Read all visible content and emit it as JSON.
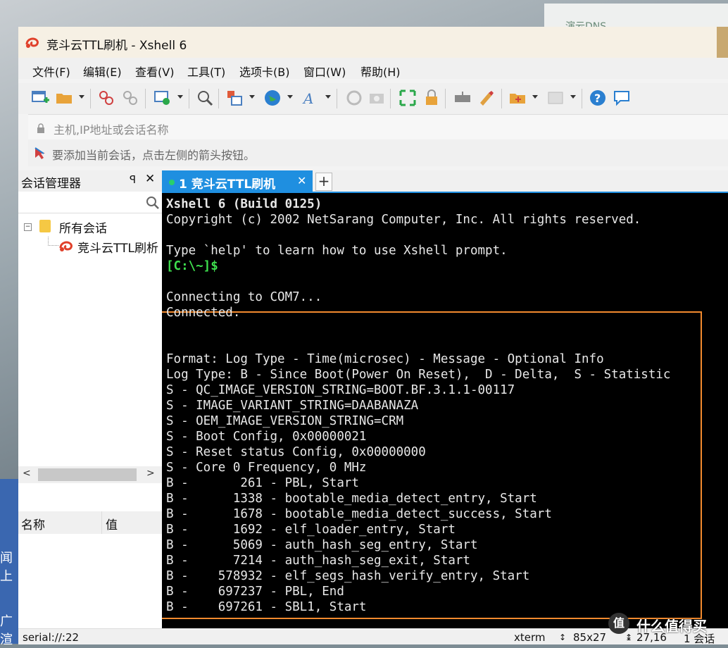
{
  "desktop": {
    "left_text_1": "闻上",
    "left_text_2": "广渲",
    "card_text": "演云DNS"
  },
  "window": {
    "title": "竞斗云TTL刷机 - Xshell 6"
  },
  "menu": [
    "文件(F)",
    "编辑(E)",
    "查看(V)",
    "工具(T)",
    "选项卡(B)",
    "窗口(W)",
    "帮助(H)"
  ],
  "address": {
    "placeholder": "主机,IP地址或会话名称"
  },
  "hint": {
    "text": "要添加当前会话，点击左侧的箭头按钮。"
  },
  "session_manager": {
    "title": "会话管理器",
    "pin": "ꟼ",
    "close": "✕",
    "tree": {
      "root": "所有会话",
      "child": "竞斗云TTL刷析"
    },
    "prop_cols": [
      "名称",
      "值"
    ]
  },
  "tabs": [
    {
      "label": "1 竞斗云TTL刷机",
      "close": "✕"
    }
  ],
  "tab_add": "+",
  "terminal": {
    "lines": [
      {
        "text": "Xshell 6 (Build 0125)",
        "style": "bold"
      },
      {
        "text": "Copyright (c) 2002 NetSarang Computer, Inc. All rights reserved.",
        "style": ""
      },
      {
        "text": "",
        "style": ""
      },
      {
        "text": "Type `help' to learn how to use Xshell prompt.",
        "style": ""
      },
      {
        "text": "[C:\\~]$",
        "style": "prompt"
      },
      {
        "text": "",
        "style": ""
      },
      {
        "text": "Connecting to COM7...",
        "style": ""
      },
      {
        "text": "Connected.",
        "style": ""
      },
      {
        "text": "",
        "style": ""
      },
      {
        "text": "",
        "style": ""
      },
      {
        "text": "Format: Log Type - Time(microsec) - Message - Optional Info",
        "style": ""
      },
      {
        "text": "Log Type: B - Since Boot(Power On Reset),  D - Delta,  S - Statistic",
        "style": ""
      },
      {
        "text": "S - QC_IMAGE_VERSION_STRING=BOOT.BF.3.1.1-00117",
        "style": ""
      },
      {
        "text": "S - IMAGE_VARIANT_STRING=DAABANAZA",
        "style": ""
      },
      {
        "text": "S - OEM_IMAGE_VERSION_STRING=CRM",
        "style": ""
      },
      {
        "text": "S - Boot Config, 0x00000021",
        "style": ""
      },
      {
        "text": "S - Reset status Config, 0x00000000",
        "style": ""
      },
      {
        "text": "S - Core 0 Frequency, 0 MHz",
        "style": ""
      },
      {
        "text": "B -       261 - PBL, Start",
        "style": ""
      },
      {
        "text": "B -      1338 - bootable_media_detect_entry, Start",
        "style": ""
      },
      {
        "text": "B -      1678 - bootable_media_detect_success, Start",
        "style": ""
      },
      {
        "text": "B -      1692 - elf_loader_entry, Start",
        "style": ""
      },
      {
        "text": "B -      5069 - auth_hash_seg_entry, Start",
        "style": ""
      },
      {
        "text": "B -      7214 - auth_hash_seg_exit, Start",
        "style": ""
      },
      {
        "text": "B -    578932 - elf_segs_hash_verify_entry, Start",
        "style": ""
      },
      {
        "text": "B -    697237 - PBL, End",
        "style": ""
      },
      {
        "text": "B -    697261 - SBL1, Start",
        "style": ""
      }
    ]
  },
  "status": {
    "connection": "serial://:22",
    "term_type": "xterm",
    "size": "85x27",
    "cursor": "27,16",
    "sessions": "1 会话"
  },
  "watermark": {
    "logo": "值",
    "text": "什么值得买"
  },
  "colors": {
    "tab_active": "#1f8fe0",
    "prompt": "#3ee04e",
    "highlight_box": "#f28a2e",
    "terminal_bg": "#000000"
  }
}
